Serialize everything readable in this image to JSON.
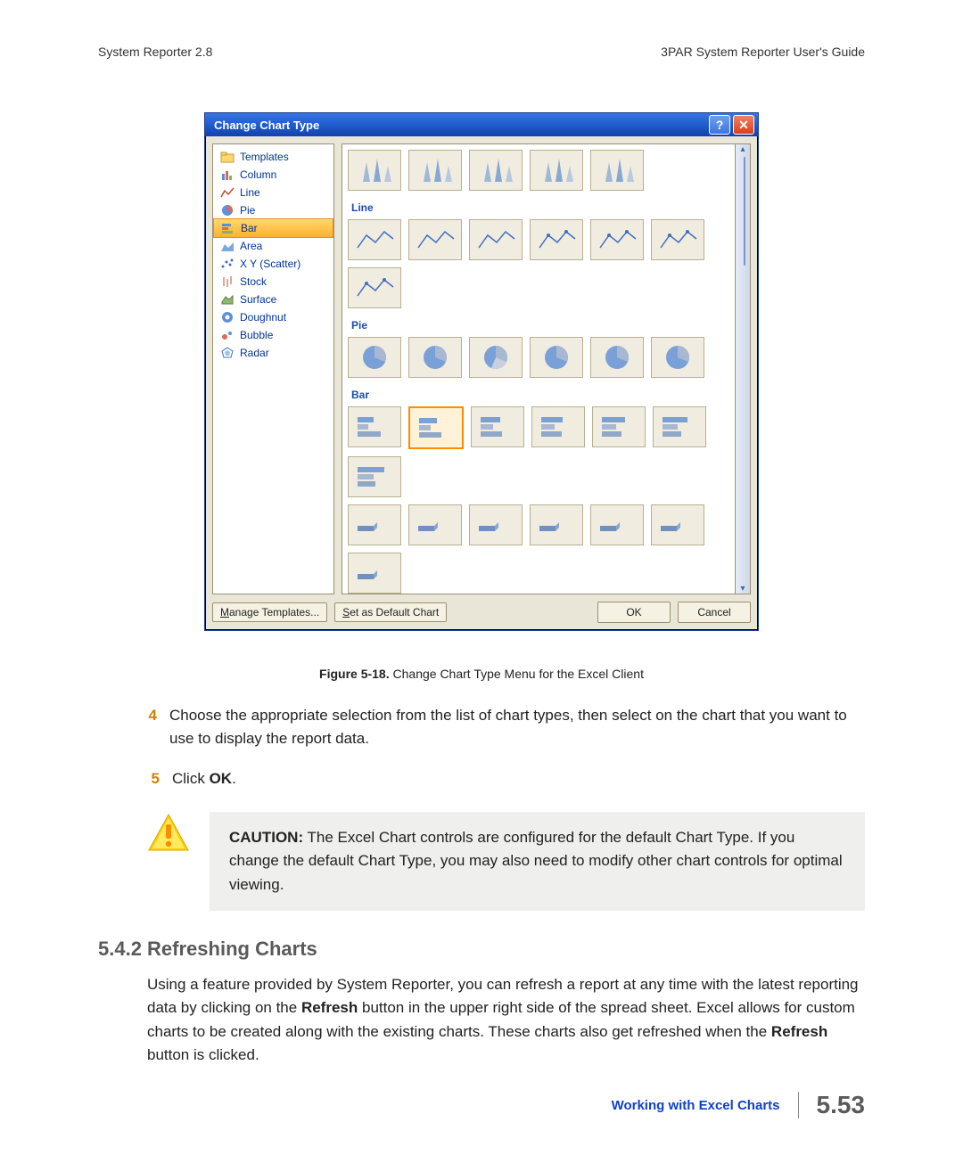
{
  "header": {
    "left": "System Reporter 2.8",
    "right": "3PAR System Reporter User's Guide"
  },
  "dialog": {
    "title": "Change Chart Type",
    "categories": [
      {
        "label": "Templates",
        "icon": "folder-icon"
      },
      {
        "label": "Column",
        "icon": "column-icon"
      },
      {
        "label": "Line",
        "icon": "line-icon"
      },
      {
        "label": "Pie",
        "icon": "pie-icon"
      },
      {
        "label": "Bar",
        "icon": "bar-icon",
        "selected": true
      },
      {
        "label": "Area",
        "icon": "area-icon"
      },
      {
        "label": "X Y (Scatter)",
        "icon": "scatter-icon"
      },
      {
        "label": "Stock",
        "icon": "stock-icon"
      },
      {
        "label": "Surface",
        "icon": "surface-icon"
      },
      {
        "label": "Doughnut",
        "icon": "doughnut-icon"
      },
      {
        "label": "Bubble",
        "icon": "bubble-icon"
      },
      {
        "label": "Radar",
        "icon": "radar-icon"
      }
    ],
    "sections": {
      "cone_count": 5,
      "line_label": "Line",
      "line_count": 7,
      "pie_label": "Pie",
      "pie_count": 6,
      "bar_label": "Bar",
      "bar_count": 7,
      "bar2_count": 7
    },
    "buttons": {
      "manage": "Manage Templates...",
      "default": "Set as Default Chart",
      "ok": "OK",
      "cancel": "Cancel"
    }
  },
  "caption": {
    "bold": "Figure 5-18.",
    "rest": "  Change Chart Type Menu for the Excel Client"
  },
  "steps": {
    "s4": {
      "num": "4",
      "text": "Choose the appropriate selection from the list of chart types, then select on the chart that you want to use to display the report data."
    },
    "s5": {
      "num": "5",
      "pre": "Click ",
      "bold": "OK",
      "post": "."
    }
  },
  "caution": {
    "bold": "CAUTION:",
    "text": " The Excel Chart controls are configured for the default Chart Type. If you change the default Chart Type, you may also need to modify other chart controls for optimal viewing."
  },
  "section_heading": "5.4.2 Refreshing Charts",
  "section_para": {
    "p1": "Using a feature provided by System Reporter, you can refresh a report at any time with the latest reporting data by clicking on the ",
    "b1": "Refresh",
    "p2": " button in the upper right side of the spread sheet. Excel allows for custom charts to be created along with the existing charts. These charts also get refreshed when the ",
    "b2": "Refresh",
    "p3": " button is clicked."
  },
  "footer": {
    "label": "Working with Excel Charts",
    "page": "5.53"
  }
}
